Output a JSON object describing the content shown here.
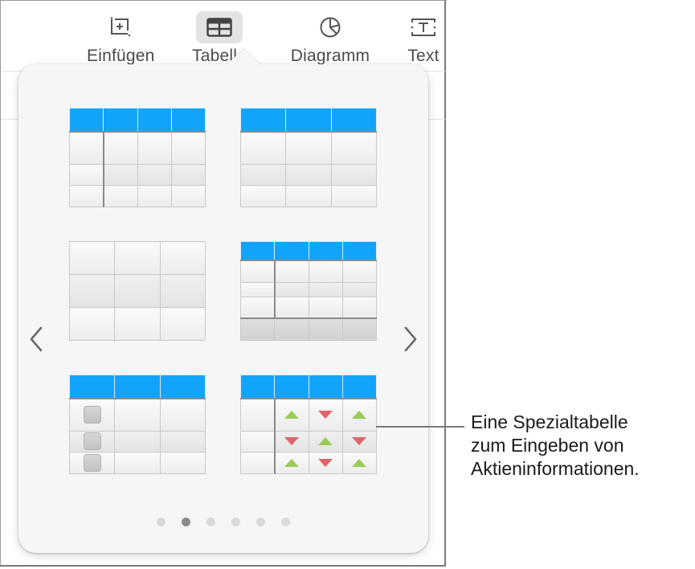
{
  "toolbar": {
    "items": [
      {
        "label": "Einfügen",
        "icon": "insert-icon",
        "active": false
      },
      {
        "label": "Tabelle",
        "icon": "table-icon",
        "active": true
      },
      {
        "label": "Diagramm",
        "icon": "chart-icon",
        "active": false
      },
      {
        "label": "Text",
        "icon": "text-box-icon",
        "active": false
      }
    ]
  },
  "popover": {
    "prev_icon": "chevron-left-icon",
    "next_icon": "chevron-right-icon",
    "table_styles": [
      {
        "name": "header-row-header-column",
        "header_color": "#12a4fb"
      },
      {
        "name": "header-row",
        "header_color": "#12a4fb"
      },
      {
        "name": "plain-grid"
      },
      {
        "name": "header-row-column-footer",
        "header_color": "#12a4fb"
      },
      {
        "name": "checklist",
        "header_color": "#12a4fb"
      },
      {
        "name": "stock-table",
        "header_color": "#12a4fb",
        "up_color": "#9ccb5a",
        "down_color": "#e06468"
      }
    ],
    "page_indicator": {
      "total": 6,
      "current": 2
    }
  },
  "callout": {
    "lines": [
      "Eine Spezialtabelle",
      "zum Eingeben von",
      "Aktieninformationen."
    ]
  }
}
